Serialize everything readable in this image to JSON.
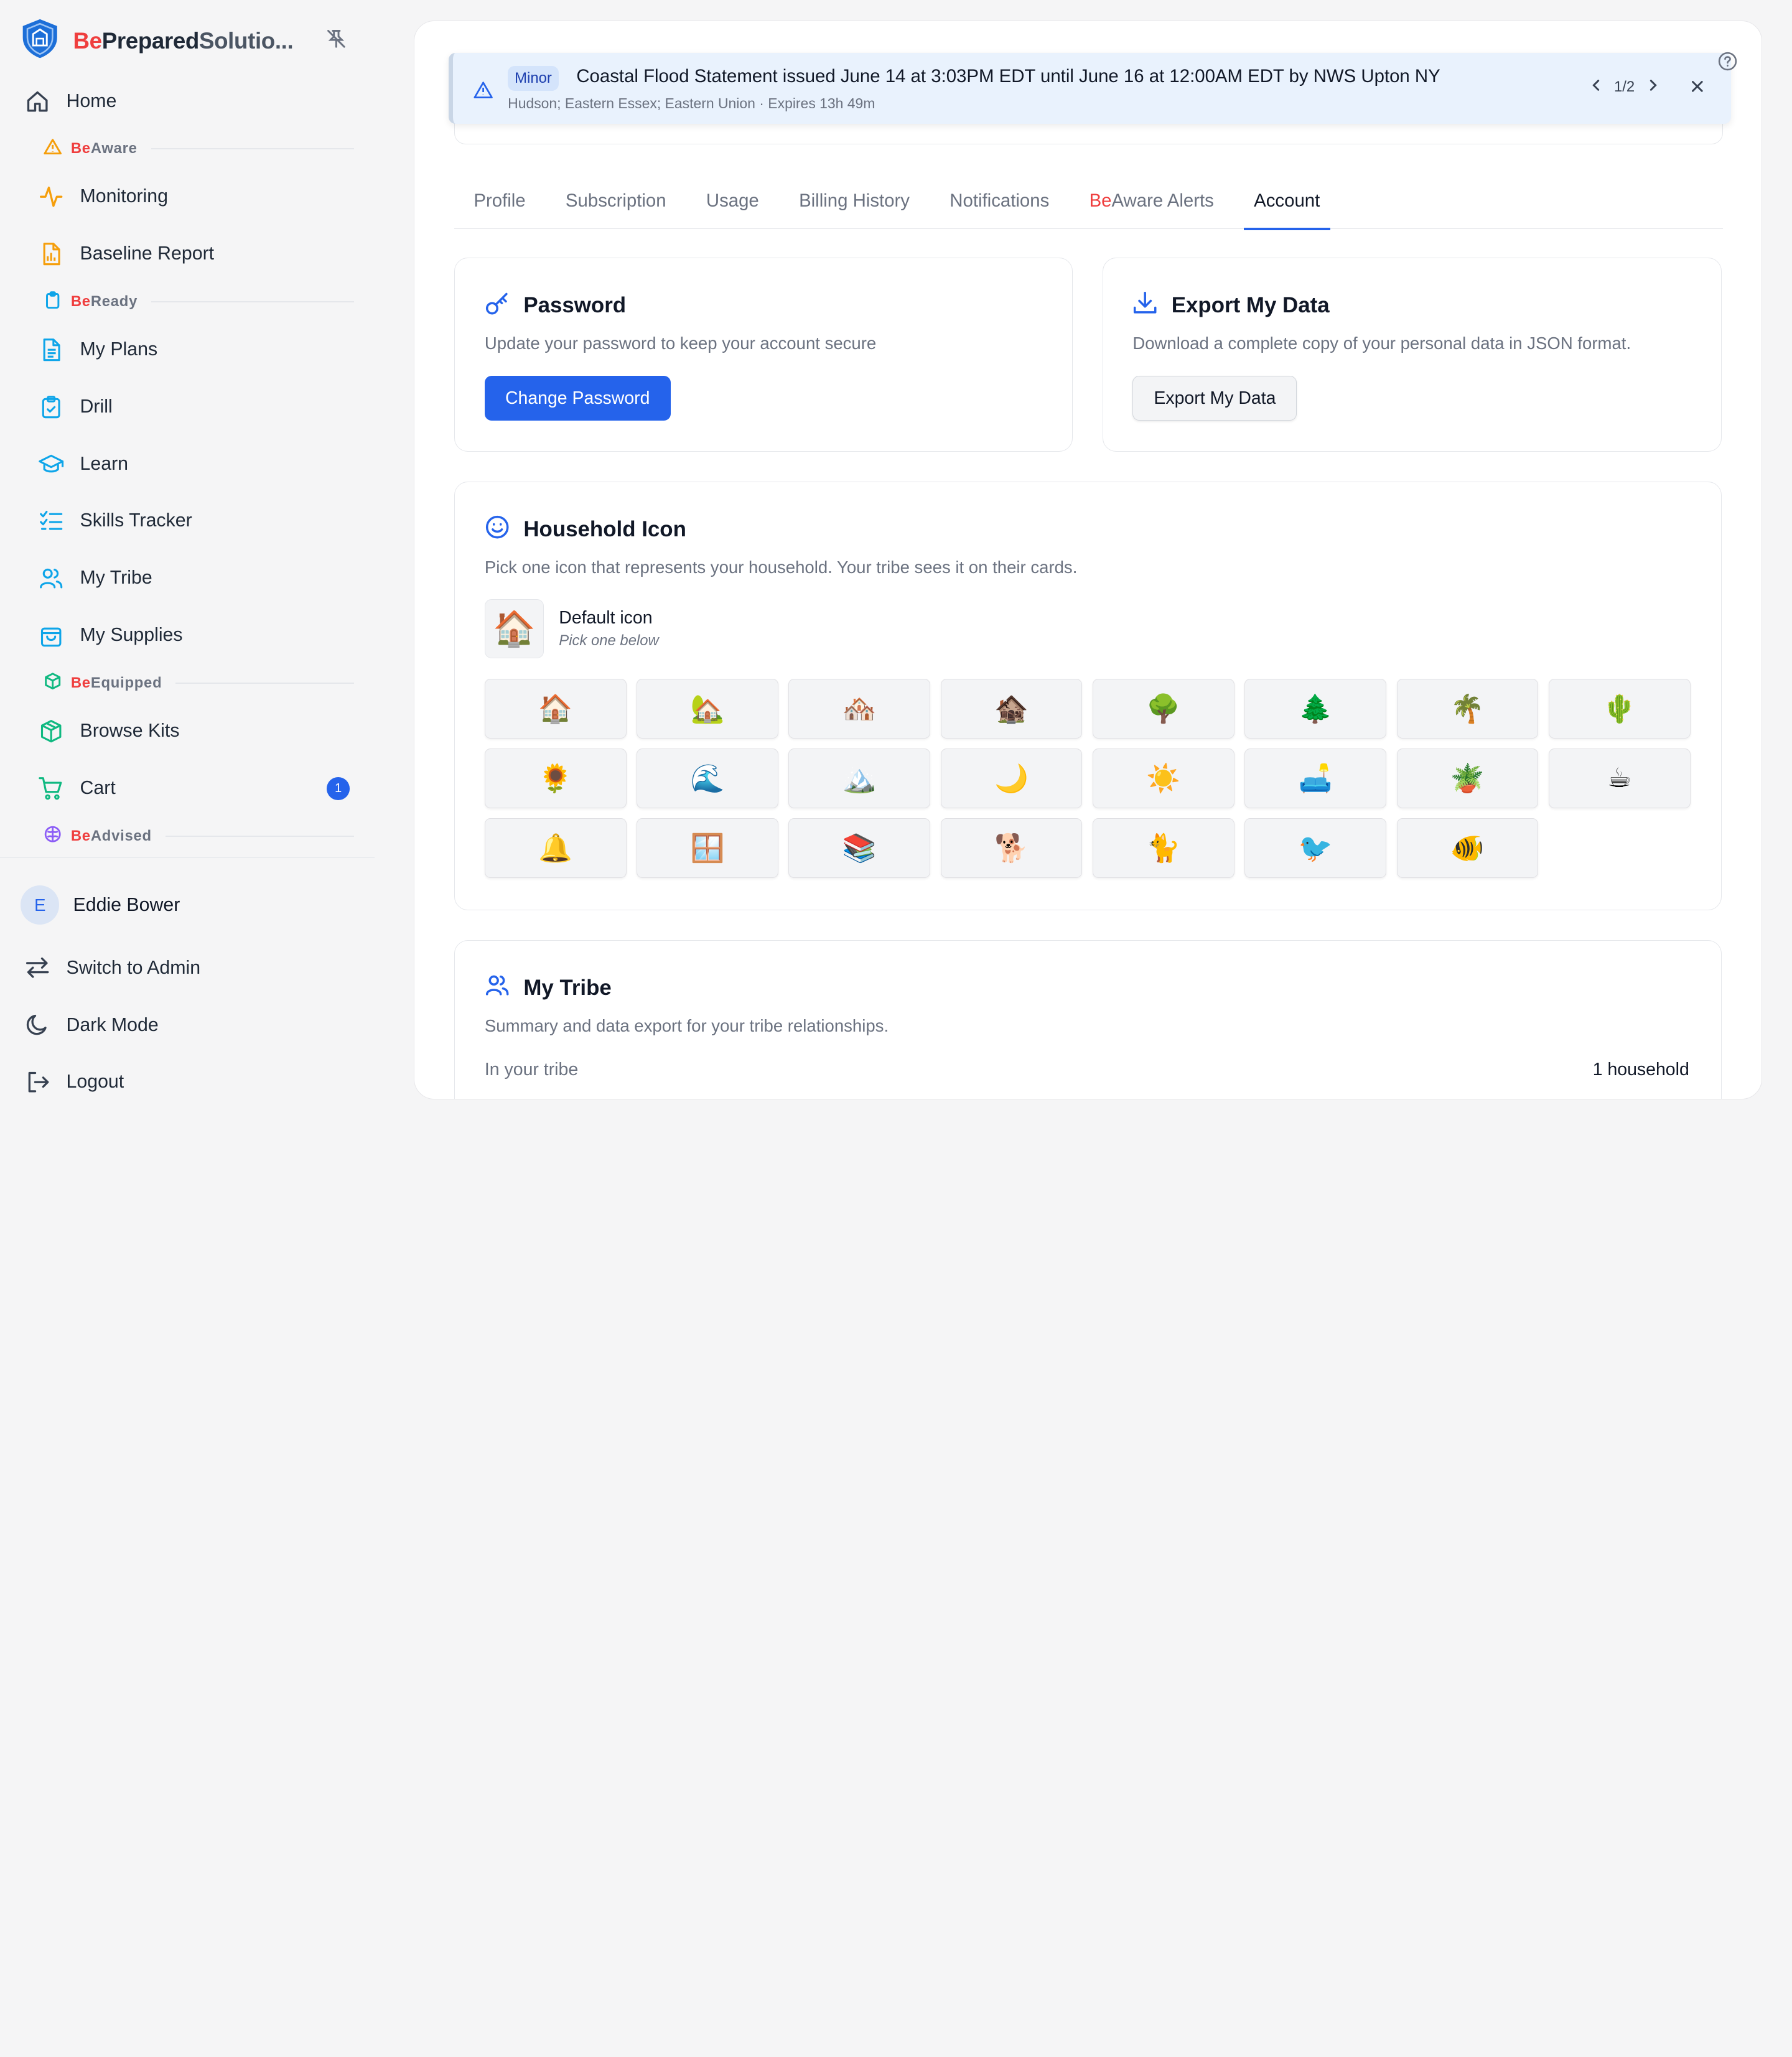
{
  "brand": {
    "be": "Be",
    "prepared": "Prepared",
    "solutions": "Solutio..."
  },
  "sidebar": {
    "home": "Home",
    "sections": [
      {
        "be": "Be",
        "name": "Aware",
        "items": [
          "Monitoring",
          "Baseline Report"
        ]
      },
      {
        "be": "Be",
        "name": "Ready",
        "items": [
          "My Plans",
          "Drill",
          "Learn",
          "Skills Tracker",
          "My Tribe",
          "My Supplies"
        ]
      },
      {
        "be": "Be",
        "name": "Equipped",
        "items": [
          "Browse Kits",
          "Cart"
        ]
      },
      {
        "be": "Be",
        "name": "Advised",
        "items": []
      }
    ],
    "cart_count": "1",
    "user_initial": "E",
    "user_name": "Eddie Bower",
    "bottom": [
      "Switch to Admin",
      "Dark Mode",
      "Logout"
    ]
  },
  "alert": {
    "severity": "Minor",
    "title": "Coastal Flood Statement issued June 14 at 3:03PM EDT until June 16 at 12:00AM EDT by NWS Upton NY",
    "sub": "Hudson; Eastern Essex; Eastern Union · Expires 13h 49m",
    "pager": "1/2"
  },
  "tabs": [
    {
      "be": "",
      "label": "Profile"
    },
    {
      "be": "",
      "label": "Subscription"
    },
    {
      "be": "",
      "label": "Usage"
    },
    {
      "be": "",
      "label": "Billing History"
    },
    {
      "be": "",
      "label": "Notifications"
    },
    {
      "be": "Be",
      "label": "Aware Alerts"
    },
    {
      "be": "",
      "label": "Account"
    }
  ],
  "password": {
    "title": "Password",
    "desc": "Update your password to keep your account secure",
    "button": "Change Password"
  },
  "export": {
    "title": "Export My Data",
    "desc": "Download a complete copy of your personal data in JSON format.",
    "button": "Export My Data"
  },
  "household": {
    "title": "Household Icon",
    "desc": "Pick one icon that represents your household. Your tribe sees it on their cards.",
    "default_icon": "🏠",
    "default_label": "Default icon",
    "default_hint": "Pick one below",
    "icons": [
      "🏠",
      "🏡",
      "🏘️",
      "🏚️",
      "🌳",
      "🌲",
      "🌴",
      "🌵",
      "🌻",
      "🌊",
      "🏔️",
      "🌙",
      "☀️",
      "🛋️",
      "🪴",
      "☕",
      "🔔",
      "🪟",
      "📚",
      "🐕",
      "🐈",
      "🐦",
      "🐠"
    ]
  },
  "tribe": {
    "title": "My Tribe",
    "desc": "Summary and data export for your tribe relationships.",
    "row_label": "In your tribe",
    "row_value": "1 household"
  },
  "colors": {
    "accent": "#2563eb",
    "brand_red": "#ef3e3e"
  }
}
